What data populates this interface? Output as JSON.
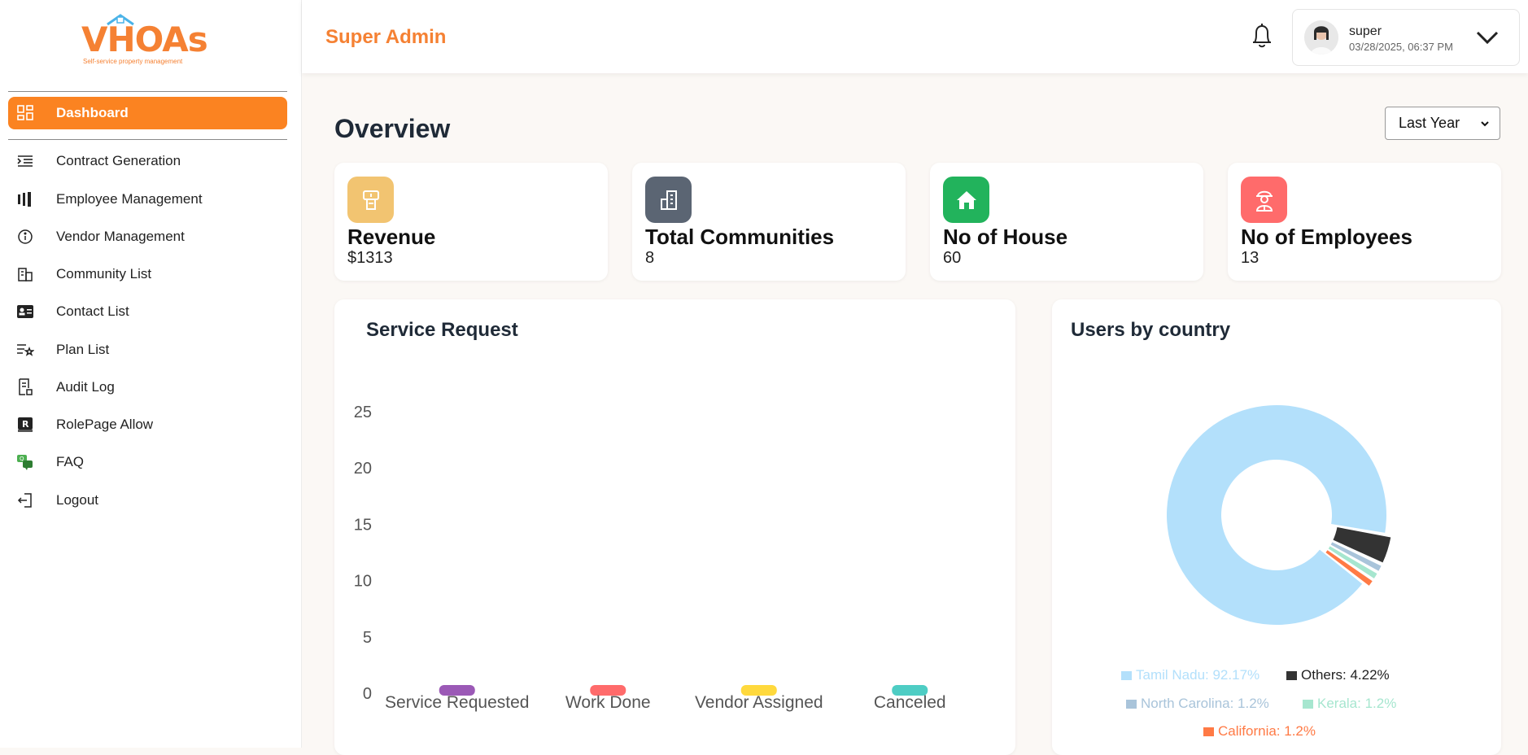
{
  "brand": {
    "name": "VHOAs",
    "tagline": "Self-service property management",
    "color": "#f58133"
  },
  "sidebar": {
    "items": [
      {
        "label": "Dashboard",
        "icon": "dashboard-grid-icon",
        "active": true
      },
      {
        "label": "Contract Generation",
        "icon": "indent-list-icon"
      },
      {
        "label": "Employee Management",
        "icon": "bars-icon"
      },
      {
        "label": "Vendor Management",
        "icon": "info-circle-icon"
      },
      {
        "label": "Community List",
        "icon": "buildings-icon"
      },
      {
        "label": "Contact List",
        "icon": "contact-card-icon"
      },
      {
        "label": "Plan List",
        "icon": "list-star-icon"
      },
      {
        "label": "Audit Log",
        "icon": "audit-doc-icon"
      },
      {
        "label": "RolePage Allow",
        "icon": "role-book-icon"
      },
      {
        "label": "FAQ",
        "icon": "chat-bubbles-icon"
      },
      {
        "label": "Logout",
        "icon": "logout-icon"
      }
    ]
  },
  "header": {
    "title": "Super Admin",
    "user": {
      "name": "super",
      "datetime": "03/28/2025, 06:37 PM"
    }
  },
  "overview": {
    "title": "Overview",
    "range": "Last Year"
  },
  "cards": [
    {
      "title": "Revenue",
      "value": "$1313",
      "icon": "money-icon",
      "color": "#f2c471"
    },
    {
      "title": "Total Communities",
      "value": "8",
      "icon": "building-icon",
      "color": "#5b6573"
    },
    {
      "title": "No of House",
      "value": "60",
      "icon": "house-icon",
      "color": "#22b35c"
    },
    {
      "title": "No of Employees",
      "value": "13",
      "icon": "worker-icon",
      "color": "#ff6b6b"
    }
  ],
  "service_panel": {
    "title": "Service Request"
  },
  "country_panel": {
    "title": "Users by country"
  },
  "chart_data": [
    {
      "type": "bar",
      "title": "Service Request",
      "categories": [
        "Service Requested",
        "Work Done",
        "Vendor Assigned",
        "Canceled"
      ],
      "values": [
        0,
        0,
        0,
        0
      ],
      "colors": [
        "#9b59b6",
        "#ff6b6b",
        "#ffd93d",
        "#4ecdc4"
      ],
      "yticks": [
        "0",
        "5",
        "10",
        "15",
        "20",
        "25"
      ],
      "ylim": [
        0,
        25
      ],
      "grid": false
    },
    {
      "type": "pie",
      "title": "Users by country",
      "donut": true,
      "slices": [
        {
          "label": "Tamil Nadu",
          "value": 92.17,
          "color": "#b3e0fb",
          "legend": "Tamil Nadu: 92.17%"
        },
        {
          "label": "California",
          "value": 1.2,
          "color": "#ff7a45",
          "legend": "California: 1.2%"
        },
        {
          "label": "Kerala",
          "value": 1.2,
          "color": "#a6e6cf",
          "legend": "Kerala: 1.2%"
        },
        {
          "label": "North Carolina",
          "value": 1.2,
          "color": "#a9c4da",
          "legend": "North Carolina: 1.2%"
        },
        {
          "label": "Others",
          "value": 4.22,
          "color": "#333333",
          "legend": "Others: 4.22%"
        }
      ],
      "legend_position": "bottom"
    }
  ]
}
